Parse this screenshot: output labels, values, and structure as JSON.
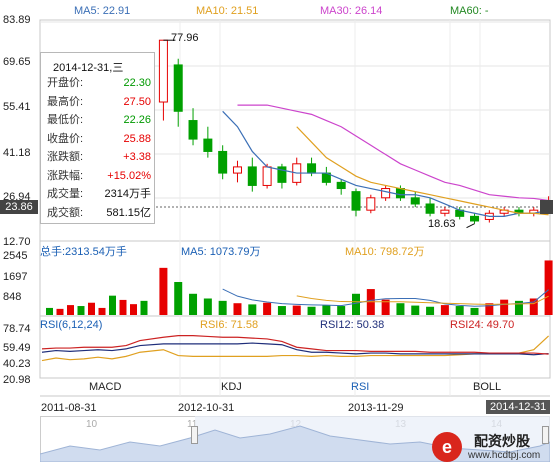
{
  "price_panel": {
    "y_labels": [
      "83.89",
      "69.65",
      "55.41",
      "41.18",
      "26.94",
      "12.70"
    ],
    "current_price": "23.86",
    "max_marker": "77.96",
    "min_marker": "18.63",
    "ma_legend": [
      {
        "label": "MA5: 22.91",
        "color": "#3b6fb6"
      },
      {
        "label": "MA10: 21.51",
        "color": "#e0a020"
      },
      {
        "label": "MA30: 26.14",
        "color": "#cc44cc"
      },
      {
        "label": "MA60: -",
        "color": "#228822"
      }
    ]
  },
  "tooltip": {
    "date": "2014-12-31,三",
    "rows": [
      {
        "k": "开盘价:",
        "v": "22.30",
        "cls": "green"
      },
      {
        "k": "最高价:",
        "v": "27.50",
        "cls": "red"
      },
      {
        "k": "最低价:",
        "v": "22.26",
        "cls": "green"
      },
      {
        "k": "收盘价:",
        "v": "25.88",
        "cls": "red"
      },
      {
        "k": "涨跌额:",
        "v": "+3.38",
        "cls": "red"
      },
      {
        "k": "涨跌幅:",
        "v": "+15.02%",
        "cls": "red"
      },
      {
        "k": "成交量:",
        "v": "2314万手",
        "cls": "blk"
      },
      {
        "k": "成交额:",
        "v": "581.15亿",
        "cls": "blk"
      }
    ]
  },
  "volume_panel": {
    "total": "总手:2313.54万手",
    "ma5": "MA5: 1073.79万",
    "ma10": "MA10: 798.72万",
    "y_labels": [
      "2545",
      "1697",
      "848"
    ]
  },
  "rsi_panel": {
    "title": "RSI(6,12,24)",
    "rsi6": "RSI6: 71.58",
    "rsi12": "RSI12: 50.38",
    "rsi24": "RSI24: 49.70",
    "y_labels": [
      "78.74",
      "59.49",
      "40.23",
      "20.98"
    ]
  },
  "indicator_tabs": [
    "MACD",
    "KDJ",
    "RSI",
    "BOLL"
  ],
  "active_tab": "RSI",
  "timeline": {
    "dates": [
      "2011-08-31",
      "2012-10-31",
      "2013-11-29",
      "2014-12-31"
    ],
    "nav_labels": [
      "10",
      "11",
      "12",
      "13",
      "14"
    ]
  },
  "watermark": {
    "brand": "配资炒股",
    "url": "www.hcdtpj.com"
  },
  "colors": {
    "up": "#e60000",
    "down": "#00a000",
    "ma5": "#3b6fb6",
    "ma10": "#e0a020",
    "ma30": "#cc44cc",
    "rsi6": "#e0a020",
    "rsi12": "#1f2e7a",
    "rsi24": "#cc2222"
  },
  "chart_data": [
    {
      "type": "candlestick",
      "title": "",
      "ylim": [
        12.7,
        83.89
      ],
      "candles": [
        {
          "o": 58,
          "h": 78,
          "l": 52,
          "c": 78
        },
        {
          "o": 70,
          "h": 72,
          "l": 50,
          "c": 55
        },
        {
          "o": 52,
          "h": 56,
          "l": 44,
          "c": 46
        },
        {
          "o": 46,
          "h": 50,
          "l": 40,
          "c": 42
        },
        {
          "o": 42,
          "h": 44,
          "l": 33,
          "c": 35
        },
        {
          "o": 35,
          "h": 39,
          "l": 32,
          "c": 37
        },
        {
          "o": 37,
          "h": 40,
          "l": 29,
          "c": 31
        },
        {
          "o": 31,
          "h": 38,
          "l": 30,
          "c": 37
        },
        {
          "o": 37,
          "h": 38,
          "l": 30,
          "c": 32
        },
        {
          "o": 32,
          "h": 40,
          "l": 31,
          "c": 38
        },
        {
          "o": 38,
          "h": 40,
          "l": 34,
          "c": 35
        },
        {
          "o": 35,
          "h": 37,
          "l": 31,
          "c": 32
        },
        {
          "o": 32,
          "h": 33,
          "l": 28,
          "c": 30
        },
        {
          "o": 29,
          "h": 30,
          "l": 21,
          "c": 23
        },
        {
          "o": 23,
          "h": 28,
          "l": 22,
          "c": 27
        },
        {
          "o": 27,
          "h": 31,
          "l": 26,
          "c": 30
        },
        {
          "o": 30,
          "h": 31,
          "l": 26,
          "c": 27
        },
        {
          "o": 27,
          "h": 29,
          "l": 24,
          "c": 25
        },
        {
          "o": 25,
          "h": 27,
          "l": 21,
          "c": 22
        },
        {
          "o": 22,
          "h": 24,
          "l": 21,
          "c": 23
        },
        {
          "o": 23,
          "h": 24,
          "l": 20,
          "c": 21
        },
        {
          "o": 21,
          "h": 22,
          "l": 18.63,
          "c": 19.5
        },
        {
          "o": 20,
          "h": 23,
          "l": 19,
          "c": 22
        },
        {
          "o": 22,
          "h": 24,
          "l": 21,
          "c": 23
        },
        {
          "o": 23,
          "h": 24,
          "l": 21,
          "c": 22
        },
        {
          "o": 22,
          "h": 24,
          "l": 21,
          "c": 23
        },
        {
          "o": 22.3,
          "h": 27.5,
          "l": 22.26,
          "c": 25.88
        }
      ],
      "ma5": [
        null,
        null,
        null,
        null,
        55,
        50,
        42,
        37,
        36,
        35,
        35,
        35,
        33,
        31,
        30,
        29,
        28,
        28,
        27,
        25,
        23,
        22,
        21,
        21,
        22,
        22,
        22.91
      ],
      "ma10": [
        null,
        null,
        null,
        null,
        null,
        null,
        null,
        null,
        null,
        50,
        45,
        40,
        37,
        34,
        32,
        31,
        30,
        29,
        28,
        27,
        26,
        25,
        24,
        23,
        22,
        22,
        21.51
      ],
      "ma30": [
        null,
        null,
        null,
        null,
        null,
        57,
        57,
        57,
        56,
        55,
        54,
        52,
        50,
        47,
        44,
        41,
        38,
        36,
        34,
        32,
        31,
        29.5,
        28,
        27.5,
        27,
        26.8,
        26.14
      ],
      "volume": [
        2000,
        1400,
        900,
        700,
        600,
        500,
        450,
        520,
        380,
        400,
        350,
        420,
        380,
        900,
        1100,
        650,
        500,
        400,
        350,
        420,
        380,
        300,
        500,
        650,
        600,
        700,
        2314
      ],
      "volume_ylim": [
        0,
        2545
      ],
      "vol_ma5": [
        null,
        null,
        null,
        null,
        1100,
        800,
        640,
        550,
        480,
        450,
        430,
        420,
        400,
        500,
        620,
        690,
        700,
        700,
        620,
        470,
        410,
        370,
        390,
        450,
        490,
        550,
        1073.79
      ],
      "vol_ma10": [
        null,
        null,
        null,
        null,
        null,
        null,
        null,
        null,
        null,
        810,
        700,
        620,
        570,
        560,
        560,
        560,
        560,
        540,
        520,
        500,
        480,
        460,
        450,
        460,
        470,
        480,
        798.72
      ],
      "rsi_ylim": [
        20.98,
        78.74
      ],
      "rsi6": [
        55,
        48,
        47,
        47,
        47,
        47,
        47,
        47,
        48,
        48,
        47,
        48,
        47,
        47,
        48,
        48,
        48,
        48,
        48,
        48,
        49,
        50,
        50,
        51,
        51,
        55,
        71.58
      ],
      "rsi12": [
        62,
        62,
        62,
        62,
        62,
        62,
        63,
        62,
        61,
        55,
        52,
        52,
        51,
        50,
        51,
        51,
        50,
        50,
        50,
        50,
        50,
        50,
        50,
        50,
        50,
        49,
        50.38
      ],
      "rsi24": [
        70,
        72,
        72,
        71,
        70,
        70,
        69,
        68,
        65,
        58,
        56,
        54,
        54,
        54,
        53,
        53,
        53,
        53,
        52,
        52,
        52,
        52,
        51,
        51,
        51,
        51,
        49.7
      ]
    }
  ]
}
